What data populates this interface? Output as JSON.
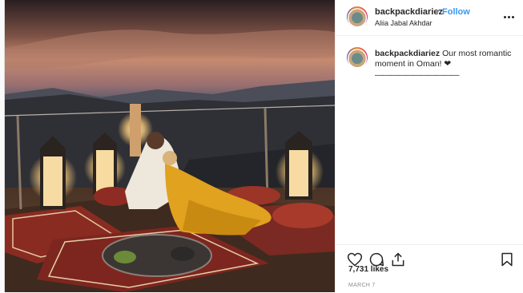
{
  "post": {
    "username": "backpackdiariez",
    "separator": "•",
    "follow_label": "Follow",
    "location": "Aliia Jabal Akhdar",
    "caption_text": "Our most romantic moment in Oman! ❤",
    "caption_rule": "———————————",
    "likes": "7,731 likes",
    "date": "MARCH 7"
  },
  "icons": {
    "more": "more-options-icon",
    "like": "heart-icon",
    "comment": "comment-icon",
    "share": "share-icon",
    "save": "bookmark-icon"
  },
  "colors": {
    "follow": "#3897f0",
    "text": "#262626",
    "muted": "#8e8e8e",
    "border": "#efefef"
  }
}
